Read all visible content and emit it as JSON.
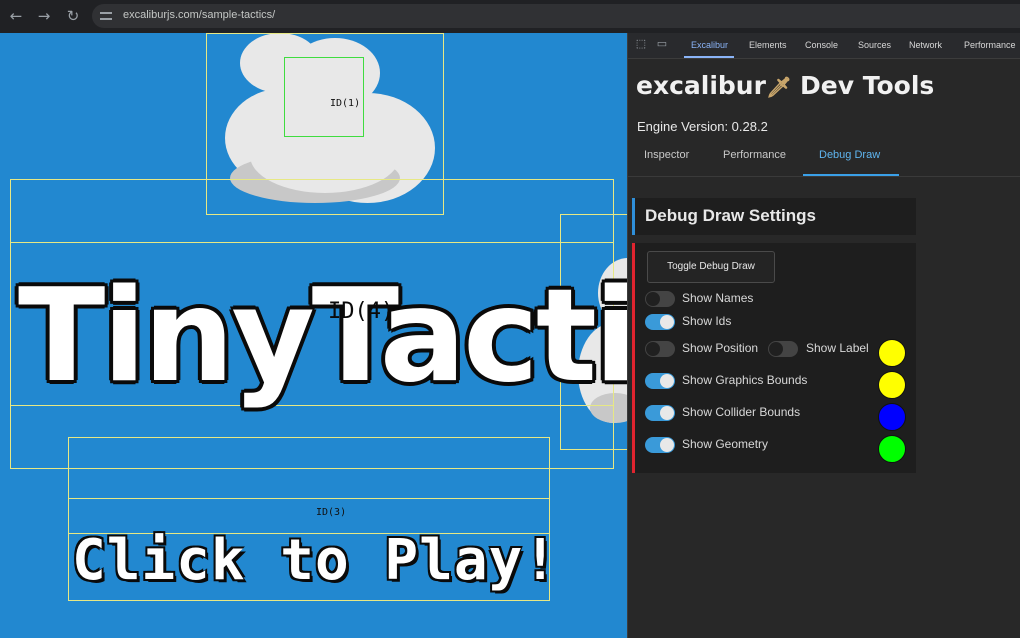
{
  "browser": {
    "url": "excaliburjs.com/sample-tactics/",
    "nav": {
      "back": "←",
      "forward": "→",
      "reload": "↻"
    }
  },
  "game": {
    "title": "TinyTactics",
    "play_prompt": "Click to Play!",
    "actor_ids": [
      "ID(1)",
      "ID(4)",
      "ID(3)"
    ]
  },
  "devtools": {
    "tabs": [
      "Excalibur",
      "Elements",
      "Console",
      "Sources",
      "Network",
      "Performance"
    ],
    "active_tab": "Excalibur",
    "brand": {
      "name": "excalibur",
      "suffix": "Dev Tools",
      "icon": "sword-icon"
    },
    "engine_version_label": "Engine Version: 0.28.2",
    "sub_tabs": [
      "Inspector",
      "Performance",
      "Debug Draw"
    ],
    "active_sub_tab": "Debug Draw",
    "settings_title": "Debug Draw Settings",
    "toggle_button": "Toggle Debug Draw",
    "options": [
      {
        "label": "Show Names",
        "on": false
      },
      {
        "label": "Show Ids",
        "on": true
      },
      {
        "label": "Show Position",
        "on": false
      },
      {
        "label": "Show Label",
        "on": false,
        "color": "#ffff00"
      },
      {
        "label": "Show Graphics Bounds",
        "on": true,
        "color": "#ffff00"
      },
      {
        "label": "Show Collider Bounds",
        "on": true,
        "color": "#0000ff"
      },
      {
        "label": "Show Geometry",
        "on": true,
        "color": "#00ff00"
      }
    ]
  },
  "colors": {
    "game_bg": "#2288d0",
    "accent": "#3a9ad9",
    "panel_red": "#e0242f"
  }
}
